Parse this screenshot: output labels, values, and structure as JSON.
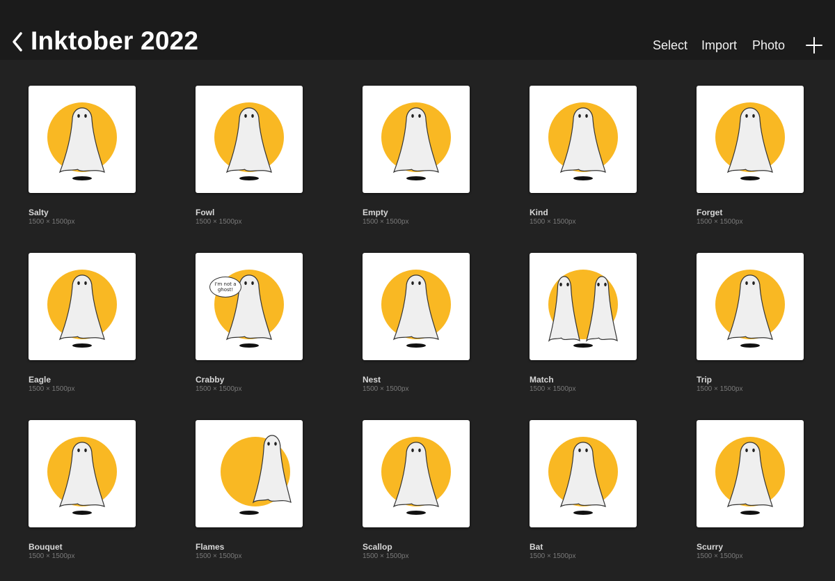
{
  "header": {
    "back_icon": "chevron-left-icon",
    "title": "Inktober 2022",
    "actions": {
      "select": "Select",
      "import": "Import",
      "photo": "Photo"
    },
    "add_icon": "plus-icon"
  },
  "colors": {
    "background": "#222222",
    "topbar": "#1b1b1b",
    "accent": "#F9B823",
    "thumb_bg": "#ffffff"
  },
  "artworks": [
    {
      "name": "Salty",
      "dims": "1500 × 1500px"
    },
    {
      "name": "Fowl",
      "dims": "1500 × 1500px"
    },
    {
      "name": "Empty",
      "dims": "1500 × 1500px"
    },
    {
      "name": "Kind",
      "dims": "1500 × 1500px"
    },
    {
      "name": "Forget",
      "dims": "1500 × 1500px"
    },
    {
      "name": "Eagle",
      "dims": "1500 × 1500px"
    },
    {
      "name": "Crabby",
      "dims": "1500 × 1500px"
    },
    {
      "name": "Nest",
      "dims": "1500 × 1500px"
    },
    {
      "name": "Match",
      "dims": "1500 × 1500px"
    },
    {
      "name": "Trip",
      "dims": "1500 × 1500px"
    },
    {
      "name": "Bouquet",
      "dims": "1500 × 1500px"
    },
    {
      "name": "Flames",
      "dims": "1500 × 1500px"
    },
    {
      "name": "Scallop",
      "dims": "1500 × 1500px"
    },
    {
      "name": "Bat",
      "dims": "1500 × 1500px"
    },
    {
      "name": "Scurry",
      "dims": "1500 × 1500px"
    }
  ],
  "crabby_bubble": "I'm not a ghost!"
}
